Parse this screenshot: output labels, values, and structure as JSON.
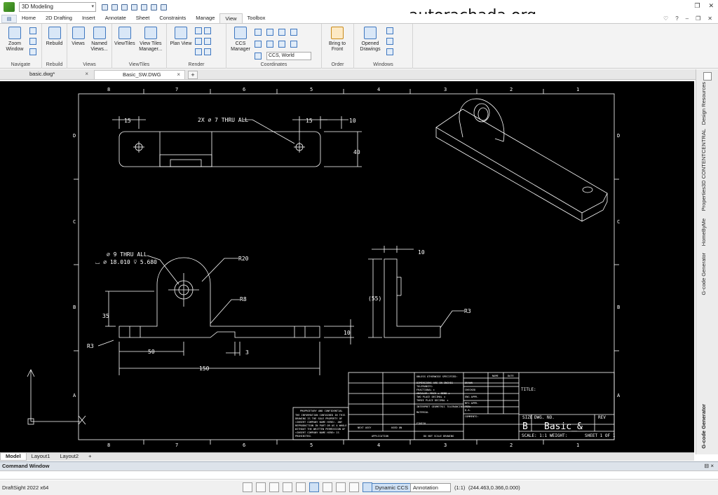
{
  "titlebar": {
    "workspace": "3D Modeling",
    "watermark": "autorachada.org"
  },
  "menu": {
    "file_icon": "app-menu-icon",
    "tabs": [
      "Home",
      "2D Drafting",
      "Insert",
      "Annotate",
      "Sheet",
      "Constraints",
      "Manage",
      "View",
      "Toolbox"
    ],
    "active_tab": "View"
  },
  "ribbon": {
    "navigate": {
      "label": "Navigate",
      "zoom": "Zoom Window",
      "zoom_arrow": "▾"
    },
    "rebuild": {
      "label": "Rebuild",
      "rebuild": "Rebuild"
    },
    "views": {
      "label": "Views",
      "views": "Views",
      "named_views": "Named Views..."
    },
    "viewtiles": {
      "label": "ViewTiles",
      "viewtiles": "ViewTiles",
      "manager": "View Tiles Manager..."
    },
    "render": {
      "label": "Render",
      "plan_view": "Plan View"
    },
    "coordinates": {
      "label": "Coordinates",
      "ccs_manager": "CCS Manager",
      "ccs_select": "CCS, World"
    },
    "order": {
      "label": "Order",
      "bring_front": "Bring to Front"
    },
    "windows": {
      "label": "Windows",
      "opened": "Opened Drawings"
    }
  },
  "doc_tabs": [
    {
      "name": "basic.dwg*",
      "close": "×"
    },
    {
      "name": "Basic_SW.DWG",
      "close": "×"
    }
  ],
  "doc_tab_add": "+",
  "drawing": {
    "col_top": [
      "8",
      "7",
      "6",
      "5",
      "4",
      "3",
      "2",
      "1"
    ],
    "col_bottom": [
      "8",
      "7",
      "6",
      "5",
      "4",
      "3",
      "2",
      "1"
    ],
    "row_left": [
      "D",
      "C",
      "B",
      "A"
    ],
    "row_right": [
      "D",
      "C",
      "B",
      "A"
    ],
    "dims": {
      "d15a": "15",
      "d15b": "15",
      "d10a": "10",
      "d40": "40",
      "hole_note": "2X ⌀ 7 THRU ALL",
      "thru_note_1": "⌀ 9 THRU ALL",
      "thru_note_2": "⌴ ⌀ 18.010 ⊽ 5.680",
      "r20": "R20",
      "r8": "R8",
      "d35": "35",
      "r3a": "R3",
      "d50": "50",
      "d3": "3",
      "d10b": "10",
      "d150": "150",
      "d10c": "10",
      "d55": "(55)",
      "r3b": "R3"
    },
    "titleblock": {
      "tolerance_head": "UNLESS OTHERWISE SPECIFIED:",
      "tol_lines": [
        "DIMENSIONS ARE IN INCHES",
        "TOLERANCES:",
        "FRACTIONAL ±",
        "ANGULAR: MACH ±   BEND ±",
        "TWO PLACE DECIMAL  ±",
        "THREE PLACE DECIMAL  ±"
      ],
      "interpret": "INTERPRET GEOMETRIC TOLERANCING PER:",
      "material": "MATERIAL",
      "finish": "FINISH",
      "next_assy": "NEXT ASSY",
      "used_on": "USED ON",
      "application": "APPLICATION",
      "do_not_scale": "DO NOT SCALE DRAWING",
      "name": "NAME",
      "date": "DATE",
      "rows": [
        "DRAWN",
        "CHECKED",
        "ENG APPR.",
        "MFG APPR.",
        "Q.A.",
        "COMMENTS:"
      ],
      "title": "TITLE:",
      "size_label": "SIZE",
      "dwg_label": "DWG.  NO.",
      "rev_label": "REV",
      "size": "B",
      "dwg_no": "Basic_&",
      "scale": "SCALE: 1:1",
      "weight": "WEIGHT:",
      "sheet": "SHEET 1 OF 1",
      "proprietary_head": "PROPRIETARY AND CONFIDENTIAL",
      "proprietary_lines": [
        "THE INFORMATION CONTAINED IN THIS",
        "DRAWING IS THE SOLE PROPERTY OF",
        "<INSERT COMPANY NAME HERE>. ANY",
        "REPRODUCTION IN PART OR AS A WHOLE",
        "WITHOUT THE WRITTEN PERMISSION OF",
        "<INSERT COMPANY NAME HERE> IS",
        "PROHIBITED."
      ]
    }
  },
  "side_tabs": [
    "Design Resources",
    "3D CONTENTCENTRAL",
    "Properties",
    "HomeByMe",
    "G-code Generator"
  ],
  "side_tab_bottom": "G-code Generator",
  "layout_tabs": [
    "Model",
    "Layout1",
    "Layout2"
  ],
  "layout_add": "+",
  "command_window": {
    "title": "Command Window",
    "ctrl": "⊟ ×"
  },
  "status": {
    "app": "DraftSight 2022 x64",
    "ccs": "Dynamic CCS",
    "annotation": "Annotation",
    "scale": "(1:1)",
    "coords": "(244.463,0.366,0.000)"
  }
}
